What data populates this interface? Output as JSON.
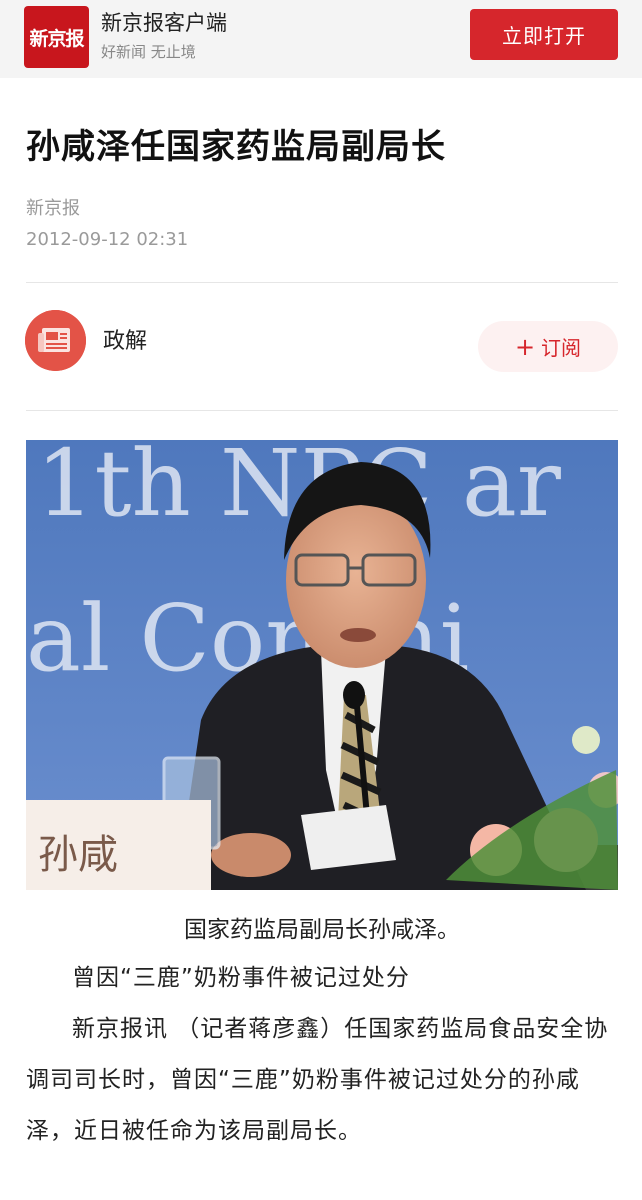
{
  "app_banner": {
    "logo_text": "新京报",
    "app_name": "新京报客户端",
    "slogan": "好新闻 无止境",
    "open_label": "立即打开",
    "brand_color": "#d6262c"
  },
  "article": {
    "title": "孙咸泽任国家药监局副局长",
    "source": "新京报",
    "datetime": "2012-09-12 02:31"
  },
  "channel": {
    "name": "政解",
    "avatar_icon": "newspaper-icon",
    "subscribe_label": "订阅",
    "subscribe_icon": "plus-icon"
  },
  "photo": {
    "backdrop_text_line1": "1th NPC ar",
    "backdrop_text_line2": "al Commi",
    "nameplate_text": "孙咸"
  },
  "body": {
    "caption": "国家药监局副局长孙咸泽。",
    "paragraphs": [
      "曾因“三鹿”奶粉事件被记过处分",
      "新京报讯 （记者蒋彦鑫）任国家药监局食品安全协调司司长时，曾因“三鹿”奶粉事件被记过处分的孙咸泽，近日被任命为该局副局长。"
    ]
  }
}
